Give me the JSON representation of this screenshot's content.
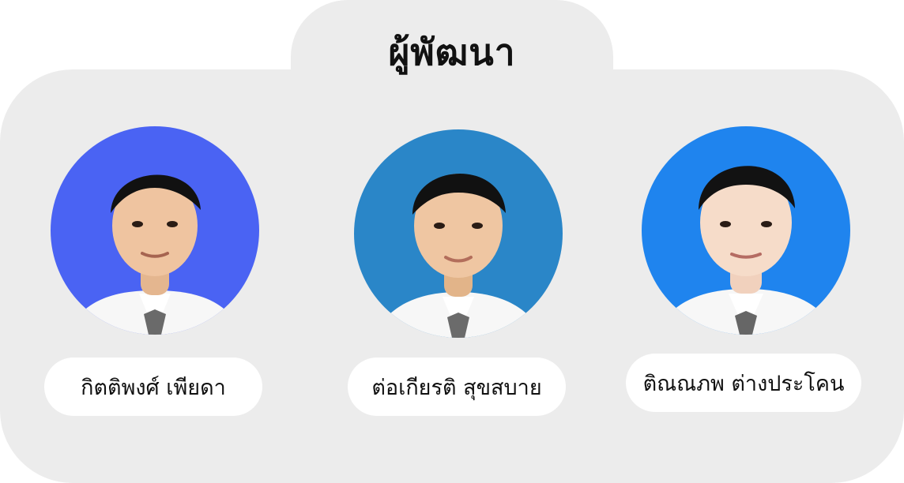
{
  "page": {
    "title": "ผู้พัฒนา"
  },
  "members": [
    {
      "name": "กิตติพงศ์ เพียดา",
      "background": "#4a63f3",
      "photo": "portrait-photo"
    },
    {
      "name": "ต่อเกียรติ สุขสบาย",
      "background": "#2a86c8",
      "photo": "portrait-photo"
    },
    {
      "name": "ติณณภพ ต่างประโคน",
      "background": "#1f84ee",
      "photo": "portrait-photo"
    }
  ],
  "colors": {
    "panel": "#ececec",
    "pill": "#ffffff",
    "text": "#111111"
  }
}
